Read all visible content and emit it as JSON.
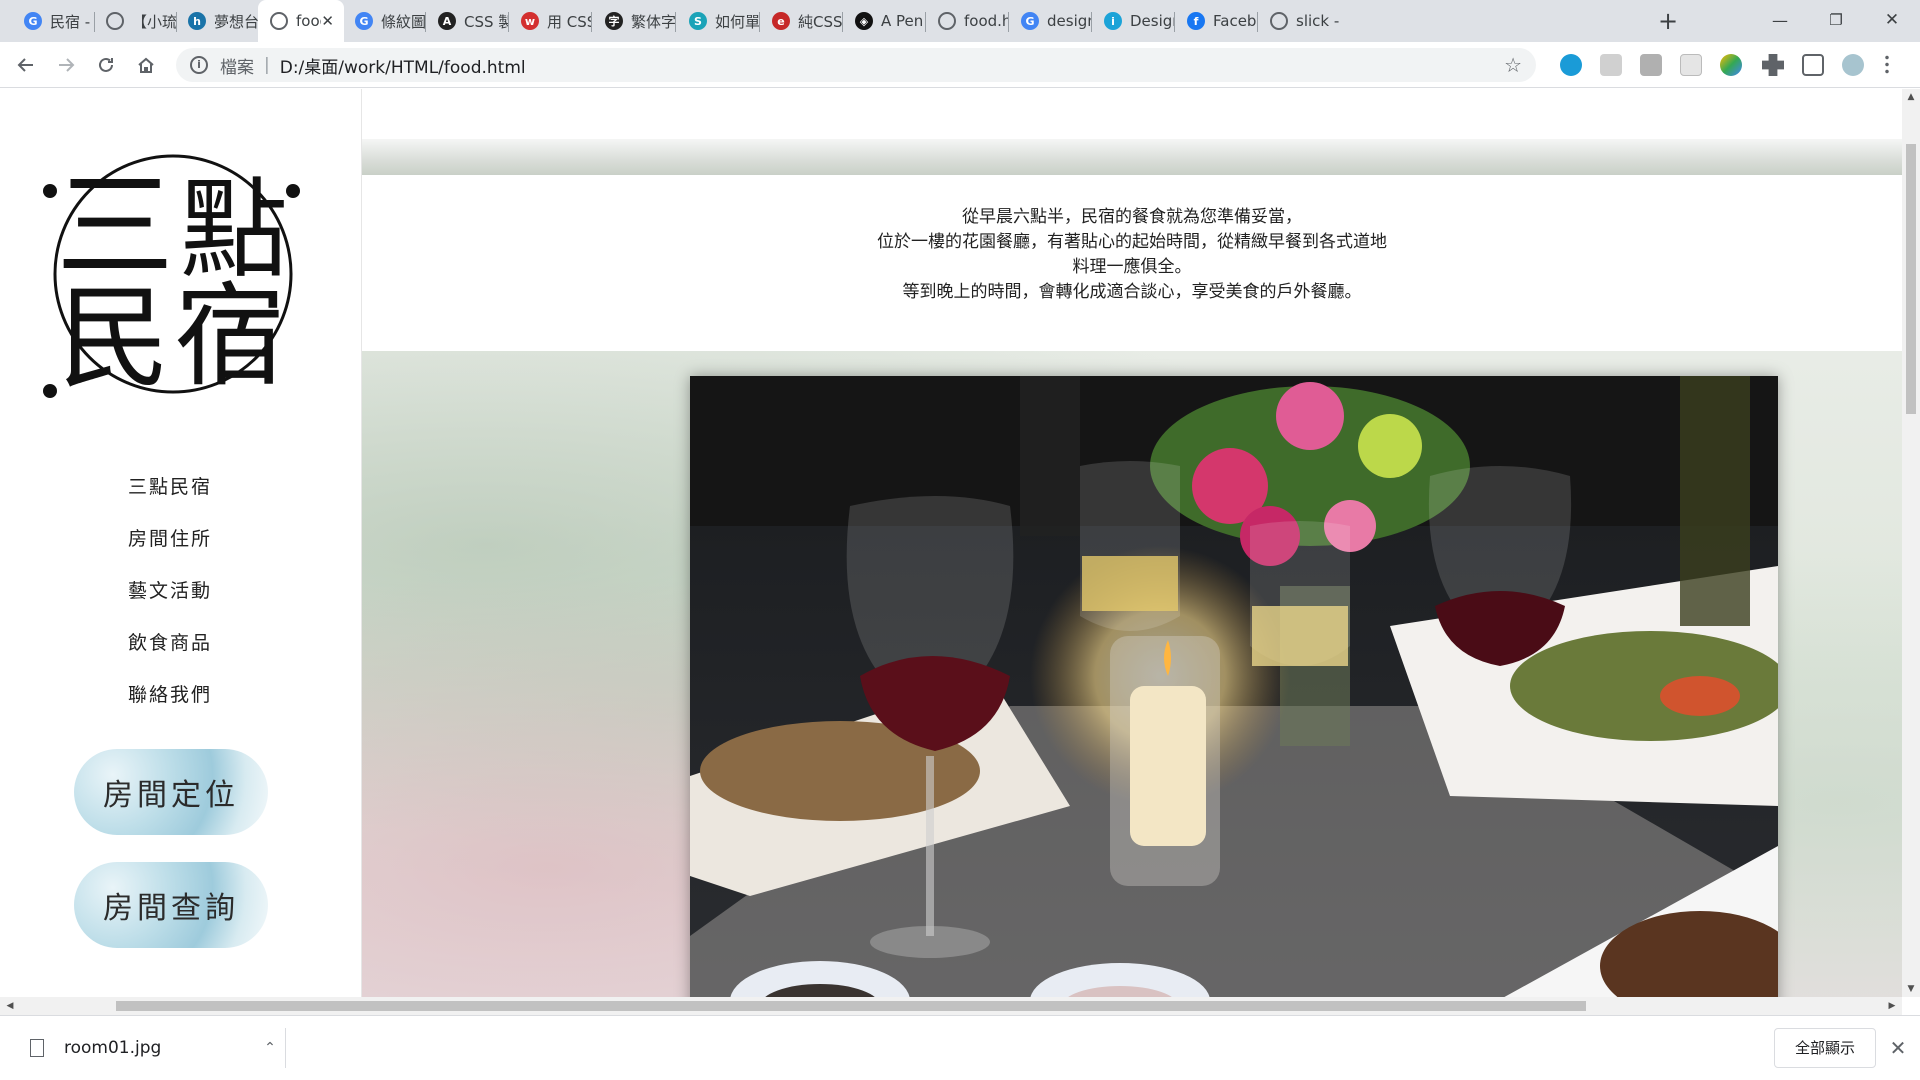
{
  "browser": {
    "tabs": [
      {
        "title": "民宿 - G",
        "icon": "google-icon",
        "color": "#4285f4",
        "glyph": "G"
      },
      {
        "title": "【小琉",
        "icon": "globe-icon",
        "color": "#5f6368",
        "glyph": ""
      },
      {
        "title": "夢想台",
        "icon": "site-icon",
        "color": "#1a73a8",
        "glyph": "h"
      },
      {
        "title": "food",
        "icon": "globe-icon",
        "color": "#5f6368",
        "glyph": "",
        "active": true
      },
      {
        "title": "條紋圖",
        "icon": "google-icon",
        "color": "#4285f4",
        "glyph": "G"
      },
      {
        "title": "CSS 製",
        "icon": "site-icon",
        "color": "#222222",
        "glyph": "A"
      },
      {
        "title": "用 CSS",
        "icon": "site-icon",
        "color": "#d32f2f",
        "glyph": "w"
      },
      {
        "title": "繁体字",
        "icon": "site-icon",
        "color": "#222222",
        "glyph": "字"
      },
      {
        "title": "如何單",
        "icon": "site-icon",
        "color": "#1ba3b8",
        "glyph": "S"
      },
      {
        "title": "純CSS",
        "icon": "site-icon",
        "color": "#c62828",
        "glyph": "e"
      },
      {
        "title": "A Pen b",
        "icon": "codepen-icon",
        "color": "#111111",
        "glyph": "◈"
      },
      {
        "title": "food.ht",
        "icon": "globe-icon",
        "color": "#5f6368",
        "glyph": ""
      },
      {
        "title": "design",
        "icon": "google-icon",
        "color": "#4285f4",
        "glyph": "G"
      },
      {
        "title": "Design",
        "icon": "site-icon",
        "color": "#1ba3d8",
        "glyph": "i"
      },
      {
        "title": "Facebo",
        "icon": "facebook-icon",
        "color": "#1877f2",
        "glyph": "f"
      },
      {
        "title": "slick - t",
        "icon": "globe-icon",
        "color": "#5f6368",
        "glyph": ""
      }
    ],
    "new_tab": "+",
    "window": {
      "minimize": "—",
      "restore": "❐",
      "close": "✕"
    },
    "address": {
      "scheme": "檔案",
      "url": "D:/桌面/work/HTML/food.html"
    }
  },
  "sidebar": {
    "logo": {
      "line1_left": "三",
      "line1_right": "點",
      "line2_left": "民",
      "line2_right": "宿"
    },
    "nav": [
      "三點民宿",
      "房間住所",
      "藝文活動",
      "飲食商品",
      "聯絡我們"
    ],
    "buttons": {
      "locate": "房間定位",
      "query": "房間查詢"
    }
  },
  "main": {
    "intro_lines": [
      "從早晨六點半，民宿的餐食就為您準備妥當，",
      "位於一樓的花園餐廳，有著貼心的起始時間，從精緻早餐到各式道地",
      "料理一應俱全。",
      "等到晚上的時間，會轉化成適合談心，享受美食的戶外餐廳。"
    ]
  },
  "downloads": {
    "file": "room01.jpg",
    "show_all": "全部顯示",
    "close": "✕"
  }
}
